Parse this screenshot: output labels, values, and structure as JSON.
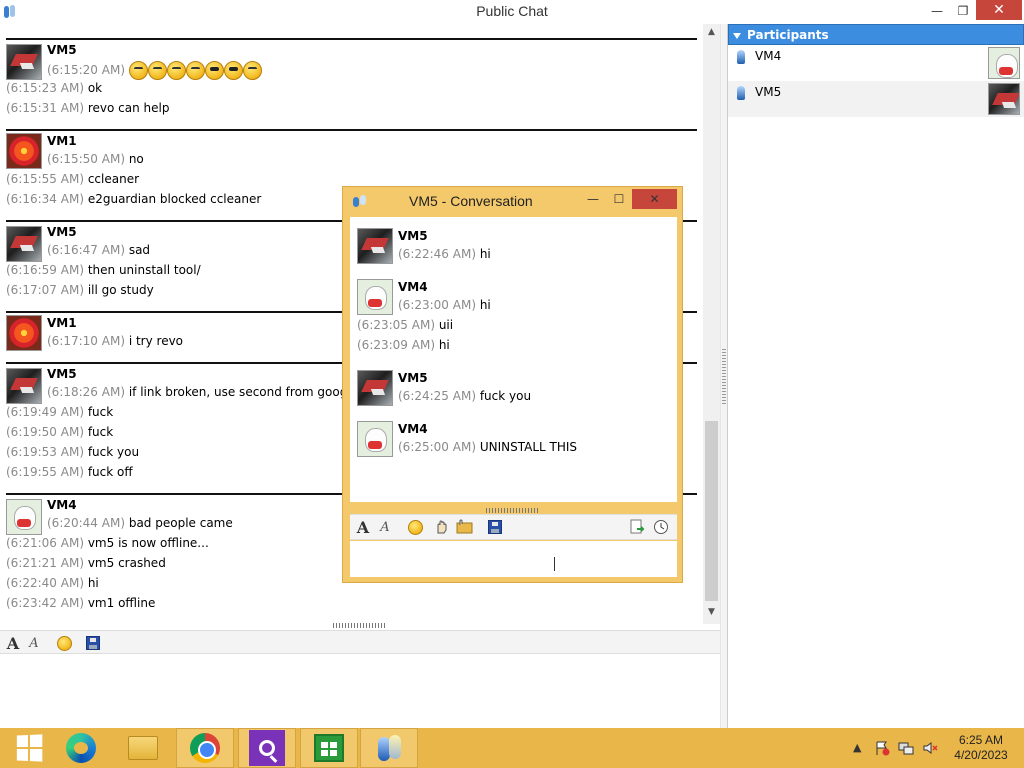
{
  "window": {
    "title": "Public Chat",
    "min_glyph": "—",
    "max_glyph": "❐",
    "close_glyph": "✕"
  },
  "chat": {
    "messages": [
      {
        "sender": "VM5",
        "avatar": "crane-avatar",
        "lines": [
          {
            "time": "(6:15:20 AM)",
            "text": "",
            "emojis": 7
          },
          {
            "time": "(6:15:23 AM)",
            "text": "ok"
          },
          {
            "time": "(6:15:31 AM)",
            "text": "revo can help"
          }
        ]
      },
      {
        "sender": "VM1",
        "avatar": "flower-avatar",
        "lines": [
          {
            "time": "(6:15:50 AM)",
            "text": "no"
          },
          {
            "time": "(6:15:55 AM)",
            "text": "ccleaner"
          },
          {
            "time": "(6:16:34 AM)",
            "text": "e2guardian blocked ccleaner"
          }
        ]
      },
      {
        "sender": "VM5",
        "avatar": "crane-avatar",
        "lines": [
          {
            "time": "(6:16:47 AM)",
            "text": "sad"
          },
          {
            "time": "(6:16:59 AM)",
            "text": "then uninstall tool/"
          },
          {
            "time": "(6:17:07 AM)",
            "text": "ill go study"
          }
        ]
      },
      {
        "sender": "VM1",
        "avatar": "flower-avatar",
        "lines": [
          {
            "time": "(6:17:10 AM)",
            "text": "i try revo"
          }
        ]
      },
      {
        "sender": "VM5",
        "avatar": "crane-avatar",
        "lines": [
          {
            "time": "(6:18:26 AM)",
            "text": "if link broken, use second from google"
          },
          {
            "time": "(6:19:49 AM)",
            "text": "fuck"
          },
          {
            "time": "(6:19:50 AM)",
            "text": "fuck"
          },
          {
            "time": "(6:19:53 AM)",
            "text": "fuck you"
          },
          {
            "time": "(6:19:55 AM)",
            "text": "fuck off"
          }
        ]
      },
      {
        "sender": "VM4",
        "avatar": "cat-avatar",
        "lines": [
          {
            "time": "(6:20:44 AM)",
            "text": "bad people came"
          },
          {
            "time": "(6:21:06 AM)",
            "text": "vm5 is now offline..."
          },
          {
            "time": "(6:21:21 AM)",
            "text": "vm5 crashed"
          },
          {
            "time": "(6:22:40 AM)",
            "text": "hi"
          },
          {
            "time": "(6:23:42 AM)",
            "text": "vm1 offline"
          }
        ]
      }
    ]
  },
  "participants": {
    "header": "Participants",
    "items": [
      {
        "name": "VM4",
        "avatar": "cat-avatar"
      },
      {
        "name": "VM5",
        "avatar": "crane-avatar"
      }
    ]
  },
  "conversation": {
    "title": "VM5 - Conversation",
    "messages": [
      {
        "sender": "VM5",
        "avatar": "crane-avatar",
        "lines": [
          {
            "time": "(6:22:46 AM)",
            "text": "hi"
          }
        ]
      },
      {
        "sender": "VM4",
        "avatar": "cat-avatar",
        "lines": [
          {
            "time": "(6:23:00 AM)",
            "text": "hi"
          },
          {
            "time": "(6:23:05 AM)",
            "text": "uii"
          },
          {
            "time": "(6:23:09 AM)",
            "text": "hi"
          }
        ]
      },
      {
        "sender": "VM5",
        "avatar": "crane-avatar",
        "lines": [
          {
            "time": "(6:24:25 AM)",
            "text": "fuck you"
          }
        ]
      },
      {
        "sender": "VM4",
        "avatar": "cat-avatar",
        "lines": [
          {
            "time": "(6:25:00 AM)",
            "text": "UNINSTALL THIS"
          }
        ]
      }
    ]
  },
  "toolbar": {
    "font_glyph": "A",
    "font_style_glyph": "A"
  },
  "taskbar": {
    "apps": [
      "start-icon",
      "edge-icon",
      "file-explorer-icon",
      "chrome-icon",
      "search-app-icon",
      "store-icon",
      "messenger-icon"
    ],
    "clock_time": "6:25 AM",
    "clock_date": "4/20/2023"
  },
  "colors": {
    "accent": "#3c8de0",
    "taskbar": "#e9b64a",
    "popup_frame": "#f4c96b",
    "timestamp": "#8a8a8a",
    "close": "#c7463c"
  }
}
